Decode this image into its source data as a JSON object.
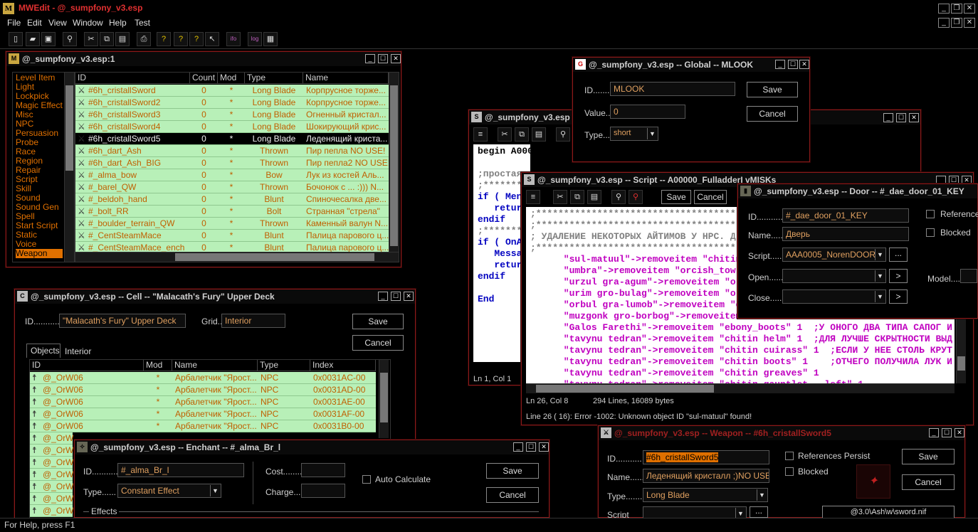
{
  "app": {
    "title": "MWEdit - @_sumpfony_v3.esp"
  },
  "menu": [
    "File",
    "Edit",
    "View",
    "Window",
    "Help",
    "Test"
  ],
  "toolbar": [
    "new-icon",
    "open-icon",
    "save-icon",
    "find-icon",
    "cut-icon",
    "copy-icon",
    "paste-icon",
    "print-icon",
    "help1-icon",
    "help2-icon",
    "help3-icon",
    "pointer-icon",
    "info-icon",
    "log-icon",
    "compile-icon"
  ],
  "object_window": {
    "title": "@_sumpfony_v3.esp:1",
    "categories": [
      "Level Item",
      "Light",
      "Lockpick",
      "Magic Effect",
      "Misc",
      "NPC",
      "Persuasion",
      "Probe",
      "Race",
      "Region",
      "Repair",
      "Script",
      "Skill",
      "Sound",
      "Sound Gen",
      "Spell",
      "Start Script",
      "Static",
      "Voice",
      "Weapon"
    ],
    "selected_category": "Weapon",
    "columns": [
      "ID",
      "Count",
      "Mod",
      "Type",
      "Name"
    ],
    "rows": [
      {
        "id": "#6h_cristallSword",
        "count": "0",
        "mod": "*",
        "type": "Long Blade",
        "name": "Корпрусное торже..."
      },
      {
        "id": "#6h_cristallSword2",
        "count": "0",
        "mod": "*",
        "type": "Long Blade",
        "name": "Корпрусное торже..."
      },
      {
        "id": "#6h_cristallSword3",
        "count": "0",
        "mod": "*",
        "type": "Long Blade",
        "name": "Огненный кристал..."
      },
      {
        "id": "#6h_cristallSword4",
        "count": "0",
        "mod": "*",
        "type": "Long Blade",
        "name": "Шокирующий крис..."
      },
      {
        "id": "#6h_cristallSword5",
        "count": "0",
        "mod": "*",
        "type": "Long Blade",
        "name": "Леденящий криста..."
      },
      {
        "id": "#6h_dart_Ash",
        "count": "0",
        "mod": "*",
        "type": "Thrown",
        "name": "Пир пепла NO USE!"
      },
      {
        "id": "#6h_dart_Ash_BIG",
        "count": "0",
        "mod": "*",
        "type": "Thrown",
        "name": "Пир пепла2 NO USE!"
      },
      {
        "id": "#_alma_bow",
        "count": "0",
        "mod": "*",
        "type": "Bow",
        "name": "Лук из костей Аль..."
      },
      {
        "id": "#_barel_QW",
        "count": "0",
        "mod": "*",
        "type": "Thrown",
        "name": "Бочонок с ... :))) N..."
      },
      {
        "id": "#_beldoh_hand",
        "count": "0",
        "mod": "*",
        "type": "Blunt",
        "name": "Спиночесалка две..."
      },
      {
        "id": "#_bolt_RR",
        "count": "0",
        "mod": "*",
        "type": "Bolt",
        "name": "Странная \"стрела\""
      },
      {
        "id": "#_boulder_terrain_QW",
        "count": "0",
        "mod": "*",
        "type": "Thrown",
        "name": "Каменный валун N..."
      },
      {
        "id": "#_CentSteamMace",
        "count": "0",
        "mod": "*",
        "type": "Blunt",
        "name": "Палица парового ц..."
      },
      {
        "id": "#_CentSteamMace_ench",
        "count": "0",
        "mod": "*",
        "type": "Blunt",
        "name": "Палица парового ц..."
      }
    ],
    "selected_row": 4
  },
  "global_window": {
    "title": "@_sumpfony_v3.esp -- Global -- MLOOK",
    "id_label": "ID.......",
    "id_value": "MLOOK",
    "value_label": "Value..",
    "value": "0",
    "type_label": "Type....",
    "type_value": "short",
    "save": "Save",
    "cancel": "Cancel"
  },
  "script1_window": {
    "title": "@_sumpfony_v3.esp",
    "lines": [
      {
        "t": "begin A000005_LOC",
        "c": "#000"
      },
      {
        "t": "",
        "c": "#000"
      },
      {
        "t": ";простая ",
        "c": "#808080"
      },
      {
        "t": ";*********",
        "c": "#808080"
      },
      {
        "t": "if ( Menu",
        "c": "#0000c0"
      },
      {
        "t": "   retur",
        "c": "#0000c0"
      },
      {
        "t": "endif",
        "c": "#0000c0"
      },
      {
        "t": ";*********",
        "c": "#808080"
      },
      {
        "t": "if ( OnAc",
        "c": "#0000c0"
      },
      {
        "t": "   Messag",
        "c": "#0000c0"
      },
      {
        "t": "   retur",
        "c": "#0000c0"
      },
      {
        "t": "endif",
        "c": "#0000c0"
      },
      {
        "t": "",
        "c": "#000"
      },
      {
        "t": "End",
        "c": "#0000c0"
      }
    ],
    "status": "Ln 1, Col 1"
  },
  "script2_window": {
    "title": "@_sumpfony_v3.esp -- Script -- A00000_FulladderI vMISKs",
    "save": "Save",
    "cancel": "Cancel",
    "lines": [
      {
        "t": ";*************************************************************",
        "c": "#808080"
      },
      {
        "t": ";*************************************************************",
        "c": "#808080"
      },
      {
        "t": "; УДАЛЕНИЕ НЕКОТОРЫХ АЙТИМОВ У НРС. Д",
        "c": "#808080"
      },
      {
        "t": ";*************************************************************",
        "c": "#808080"
      },
      {
        "t": "      \"sul-matuul\"->removeitem \"chitin",
        "c": "#c000c0"
      },
      {
        "t": "      \"umbra\"->removeitem \"orcish_tow",
        "c": "#c000c0"
      },
      {
        "t": "      \"urzul gra-agum\"->removeitem \"o",
        "c": "#c000c0"
      },
      {
        "t": "      \"urim gro-bulag\"->removeitem \"o",
        "c": "#c000c0"
      },
      {
        "t": "      \"orbul gra-lumob\"->removeitem \"o",
        "c": "#c000c0"
      },
      {
        "t": "      \"muzgonk gro-borbog\"->removeitem",
        "c": "#c000c0"
      },
      {
        "t": "      \"Galos Farethi\"->removeitem \"ebony_boots\" 1  ;У ОНОГО ДВА ТИПА САПОГ И",
        "c": "#c000c0"
      },
      {
        "t": "      \"tavynu tedran\"->removeitem \"chitin helm\" 1  ;ДЛЯ ЛУЧШЕ СКРЫТНОСТИ ВЫД",
        "c": "#c000c0"
      },
      {
        "t": "      \"tavynu tedran\"->removeitem \"chitin cuirass\" 1  ;ЕСЛИ У НЕЕ СТОЛЬ КРУТ",
        "c": "#c000c0"
      },
      {
        "t": "      \"tavynu tedran\"->removeitem \"chitin boots\" 1    ;ОТЧЕГО ПОЛУЧИЛА ЛУК И",
        "c": "#c000c0"
      },
      {
        "t": "      \"tavynu tedran\"->removeitem \"chitin greaves\" 1",
        "c": "#c000c0"
      },
      {
        "t": "      \"tavynu tedran\"->removeitem \"chitin gauntlet - left\" 1",
        "c": "#c000c0"
      }
    ],
    "status_pos": "Ln 26, Col 8",
    "status_lines": "294 Lines, 16089 bytes",
    "error": "Line   26 ( 16): Error -1002: Unknown object ID \"sul-matuul\" found!"
  },
  "door_window": {
    "title": "@_sumpfony_v3.esp -- Door -- #_dae_door_01_KEY",
    "id_label": "ID...........",
    "id_value": "#_dae_door_01_KEY",
    "name_label": "Name.........",
    "name_value": "Дверь",
    "script_label": "Script.......",
    "script_value": "AAA0005_NorenDOOR",
    "open_label": "Open.........",
    "close_label": "Close.........",
    "references": "Reference",
    "blocked": "Blocked",
    "model_label": "Model......"
  },
  "cell_window": {
    "title": "@_sumpfony_v3.esp -- Cell -- \"Malacath's Fury\" Upper Deck",
    "id_label": "ID...........",
    "id_value": "\"Malacath's Fury\" Upper Deck",
    "grid_label": "Grid...",
    "grid_value": "Interior",
    "save": "Save",
    "cancel": "Cancel",
    "tabs": [
      "Objects",
      "Interior"
    ],
    "columns": [
      "ID",
      "Mod",
      "Name",
      "Type",
      "Index"
    ],
    "rows": [
      {
        "id": "@_OrW06",
        "mod": "*",
        "name": "Арбалетчик \"Ярост...",
        "type": "NPC",
        "index": "0x0031AC-00"
      },
      {
        "id": "@_OrW06",
        "mod": "*",
        "name": "Арбалетчик \"Ярост...",
        "type": "NPC",
        "index": "0x0031AD-00"
      },
      {
        "id": "@_OrW06",
        "mod": "*",
        "name": "Арбалетчик \"Ярост...",
        "type": "NPC",
        "index": "0x0031AE-00"
      },
      {
        "id": "@_OrW06",
        "mod": "*",
        "name": "Арбалетчик \"Ярост...",
        "type": "NPC",
        "index": "0x0031AF-00"
      },
      {
        "id": "@_OrW06",
        "mod": "*",
        "name": "Арбалетчик \"Ярост...",
        "type": "NPC",
        "index": "0x0031B0-00"
      },
      {
        "id": "@_OrW",
        "mod": "",
        "name": "",
        "type": "",
        "index": ""
      },
      {
        "id": "@_OrW",
        "mod": "",
        "name": "",
        "type": "",
        "index": ""
      },
      {
        "id": "@_OrW",
        "mod": "",
        "name": "",
        "type": "",
        "index": ""
      },
      {
        "id": "@_OrW",
        "mod": "",
        "name": "",
        "type": "",
        "index": ""
      },
      {
        "id": "@_OrW",
        "mod": "",
        "name": "",
        "type": "",
        "index": ""
      },
      {
        "id": "@_OrW",
        "mod": "",
        "name": "",
        "type": "",
        "index": ""
      },
      {
        "id": "@_OrW",
        "mod": "",
        "name": "",
        "type": "",
        "index": ""
      }
    ]
  },
  "enchant_window": {
    "title": "@_sumpfony_v3.esp -- Enchant -- #_alma_Br_l",
    "id_label": "ID............",
    "id_value": "#_alma_Br_l",
    "type_label": "Type......",
    "type_value": "Constant Effect",
    "cost_label": "Cost........",
    "charge_label": "Charge........",
    "auto_calc": "Auto Calculate",
    "save": "Save",
    "cancel": "Cancel",
    "effects": "Effects"
  },
  "weapon_window": {
    "title": "@_sumpfony_v3.esp -- Weapon -- #6h_cristallSword5",
    "id_label": "ID...........",
    "id_value": "#6h_cristallSword5",
    "name_label": "Name.........",
    "name_value": "Леденящий кристалл ;)NO USE!",
    "type_label": "Type.........",
    "type_value": "Long Blade",
    "script_label": "Script",
    "references": "References Persist",
    "blocked": "Blocked",
    "save": "Save",
    "cancel": "Cancel",
    "model": "@3.0\\Ash\\w\\sword.nif"
  },
  "statusbar": {
    "text": "For Help, press F1"
  }
}
